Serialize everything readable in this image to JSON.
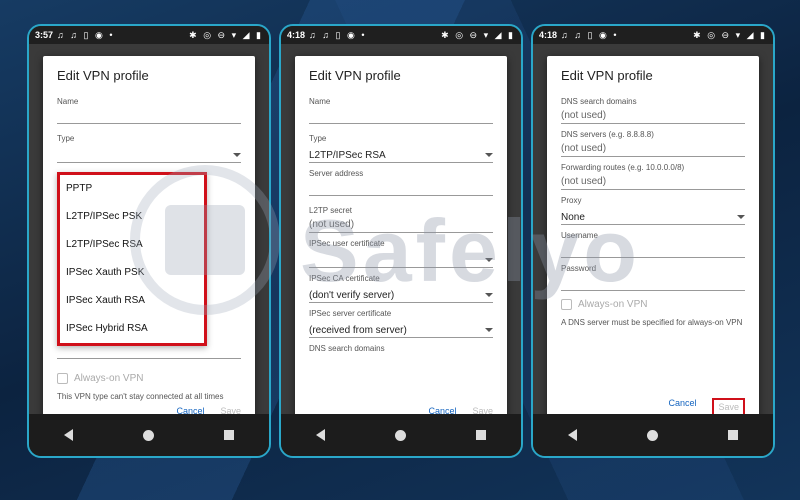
{
  "phone1": {
    "status_time": "3:57",
    "dialog_title": "Edit VPN profile",
    "name_label": "Name",
    "type_label": "Type",
    "type_menu": [
      "PPTP",
      "L2TP/IPSec PSK",
      "L2TP/IPSec RSA",
      "IPSec Xauth PSK",
      "IPSec Xauth RSA",
      "IPSec Hybrid RSA"
    ],
    "always_on_label": "Always-on VPN",
    "note": "This VPN type can't stay connected at all times",
    "cancel": "Cancel",
    "save": "Save"
  },
  "phone2": {
    "status_time": "4:18",
    "dialog_title": "Edit VPN profile",
    "name_label": "Name",
    "type_label": "Type",
    "type_value": "L2TP/IPSec RSA",
    "server_address_label": "Server address",
    "l2tp_secret_label": "L2TP secret",
    "l2tp_secret_value": "(not used)",
    "user_cert_label": "IPSec user certificate",
    "ca_cert_label": "IPSec CA certificate",
    "ca_cert_value": "(don't verify server)",
    "server_cert_label": "IPSec server certificate",
    "server_cert_value": "(received from server)",
    "dns_label": "DNS search domains",
    "cancel": "Cancel",
    "save": "Save"
  },
  "phone3": {
    "status_time": "4:18",
    "dialog_title": "Edit VPN profile",
    "dns_search_label": "DNS search domains",
    "dns_search_value": "(not used)",
    "dns_servers_label": "DNS servers (e.g. 8.8.8.8)",
    "dns_servers_value": "(not used)",
    "forwarding_label": "Forwarding routes (e.g. 10.0.0.0/8)",
    "forwarding_value": "(not used)",
    "proxy_label": "Proxy",
    "proxy_value": "None",
    "username_label": "Username",
    "password_label": "Password",
    "always_on_label": "Always-on VPN",
    "note": "A DNS server must be specified for always-on VPN",
    "cancel": "Cancel",
    "save": "Save"
  },
  "watermark": "Safelyo",
  "icons": {
    "status_left": "♫ ♫ ▯ ◉ •",
    "status_right": "✱ ◎ ⊖ ▾ ◢ ▮",
    "nav_back": "back-icon",
    "nav_home": "home-icon",
    "nav_recent": "recent-apps-icon"
  },
  "colors": {
    "highlight": "#d0101a",
    "link": "#1565c0",
    "phone_border": "#2aa7c9"
  }
}
